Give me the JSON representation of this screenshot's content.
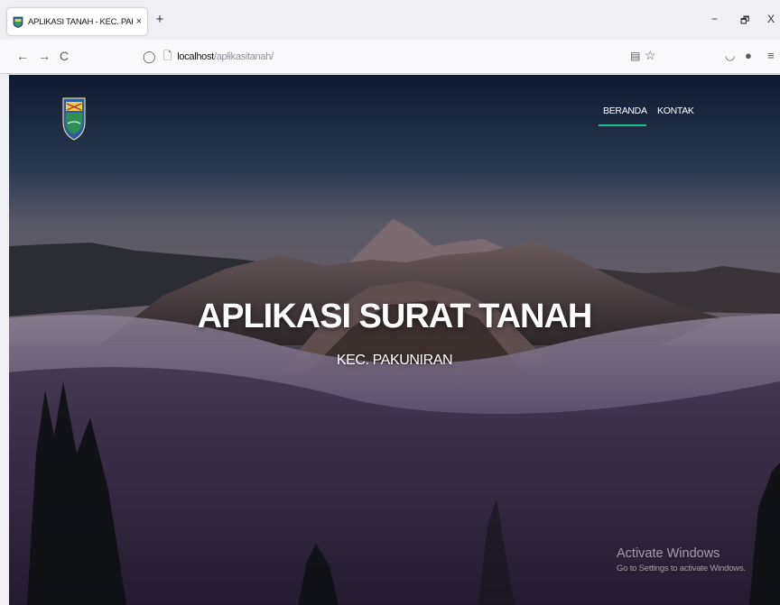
{
  "browser": {
    "tab_title": "APLIKASI TANAH - KEC. PAKUNIRAN",
    "tab_close": "×",
    "new_tab": "+",
    "url_host": "localhost",
    "url_path": "/aplikasitanah/",
    "window": {
      "minimize": "−",
      "maximize": "🗗",
      "close": "X"
    },
    "icons": {
      "back": "←",
      "forward": "→",
      "reload": "C",
      "shield": "◯",
      "page": "🗋",
      "reader": "▤",
      "star": "☆",
      "pocket": "◡",
      "account": "●",
      "menu": "≡"
    }
  },
  "site": {
    "nav": {
      "home": "BERANDA",
      "contact": "KONTAK"
    },
    "hero": {
      "title": "APLIKASI SURAT TANAH",
      "subtitle": "KEC. PAKUNIRAN"
    },
    "accent_color": "#1fbf8f"
  },
  "watermark": {
    "title": "Activate Windows",
    "subtitle": "Go to Settings to activate Windows."
  }
}
